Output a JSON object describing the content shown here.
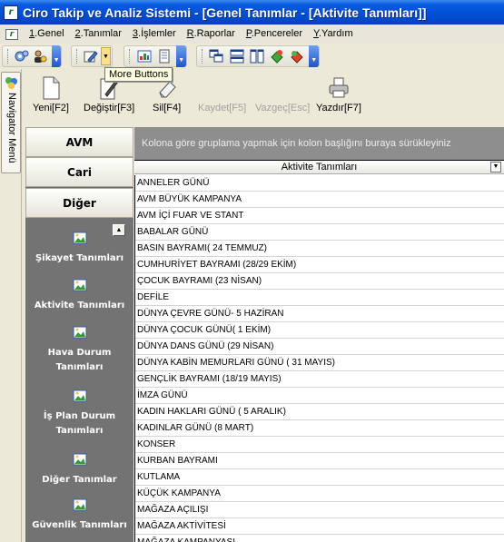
{
  "window": {
    "title": "Ciro Takip ve Analiz Sistemi - [Genel Tanımlar - [Aktivite Tanımları]]"
  },
  "menu": [
    {
      "key": "1",
      "label": ".Genel"
    },
    {
      "key": "2",
      "label": ".Tanımlar"
    },
    {
      "key": "3",
      "label": ".İşlemler"
    },
    {
      "key": "R",
      "label": ".Raporlar"
    },
    {
      "key": "P",
      "label": ".Pencereler"
    },
    {
      "key": "Y",
      "label": ".Yardım"
    }
  ],
  "tooltip": "More Buttons",
  "navigator_tab": "Navigator Menü",
  "actions": {
    "new": "Yeni[F2]",
    "edit": "Değiştir[F3]",
    "delete": "Sil[F4]",
    "save": "Kaydet[F5]",
    "cancel": "Vazgeç[Esc]",
    "print": "Yazdır[F7]"
  },
  "nav_sections": {
    "avm": "AVM",
    "cari": "Cari",
    "diger": "Diğer"
  },
  "nav_items": [
    "Şikayet Tanımları",
    "Aktivite Tanımları",
    "Hava Durum\nTanımları",
    "İş Plan Durum\nTanımları",
    "Diğer Tanımlar",
    "Güvenlik Tanımları"
  ],
  "grid": {
    "group_hint": "Kolona göre gruplama yapmak için kolon başlığını buraya sürükleyiniz",
    "column": "Aktivite Tanımları",
    "rows": [
      "ANNELER GÜNÜ",
      "AVM BÜYÜK KAMPANYA",
      "AVM İÇİ FUAR VE STANT",
      "BABALAR GÜNÜ",
      "BASIN BAYRAMI( 24 TEMMUZ)",
      "CUMHURİYET BAYRAMI (28/29 EKİM)",
      "ÇOCUK BAYRAMI (23 NİSAN)",
      "DEFİLE",
      "DÜNYA ÇEVRE GÜNÜ- 5 HAZİRAN",
      "DÜNYA ÇOCUK GÜNÜ( 1 EKİM)",
      "DÜNYA DANS GÜNÜ (29 NİSAN)",
      "DÜNYA KABİN MEMURLARI GÜNÜ ( 31 MAYIS)",
      "GENÇLİK BAYRAMI (18/19 MAYIS)",
      "İMZA GÜNÜ",
      "KADIN HAKLARI GÜNÜ ( 5 ARALIK)",
      "KADINLAR GÜNÜ (8 MART)",
      "KONSER",
      "KURBAN BAYRAMI",
      "KUTLAMA",
      "KÜÇÜK KAMPANYA",
      "MAĞAZA AÇILIŞI",
      "MAĞAZA AKTİVİTESİ",
      "MAĞAZA KAMPANYASI"
    ]
  }
}
